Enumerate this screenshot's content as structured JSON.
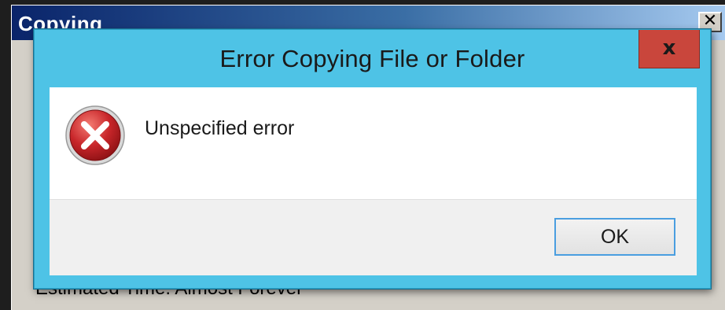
{
  "background_window": {
    "title": "Copying",
    "close_glyph": "✕",
    "status_text": "Estimated Time: Almost Forever"
  },
  "dialog": {
    "title": "Error Copying File or Folder",
    "close_glyph": "x",
    "message": "Unspecified error",
    "icon": "error-icon",
    "ok_label": "OK"
  },
  "colors": {
    "dialog_frame": "#4ec3e6",
    "close_button": "#c9463c",
    "content_bg": "#ffffff",
    "footer_bg": "#f0f0f0",
    "ok_border": "#4a9ee0",
    "error_red": "#c8262a"
  }
}
